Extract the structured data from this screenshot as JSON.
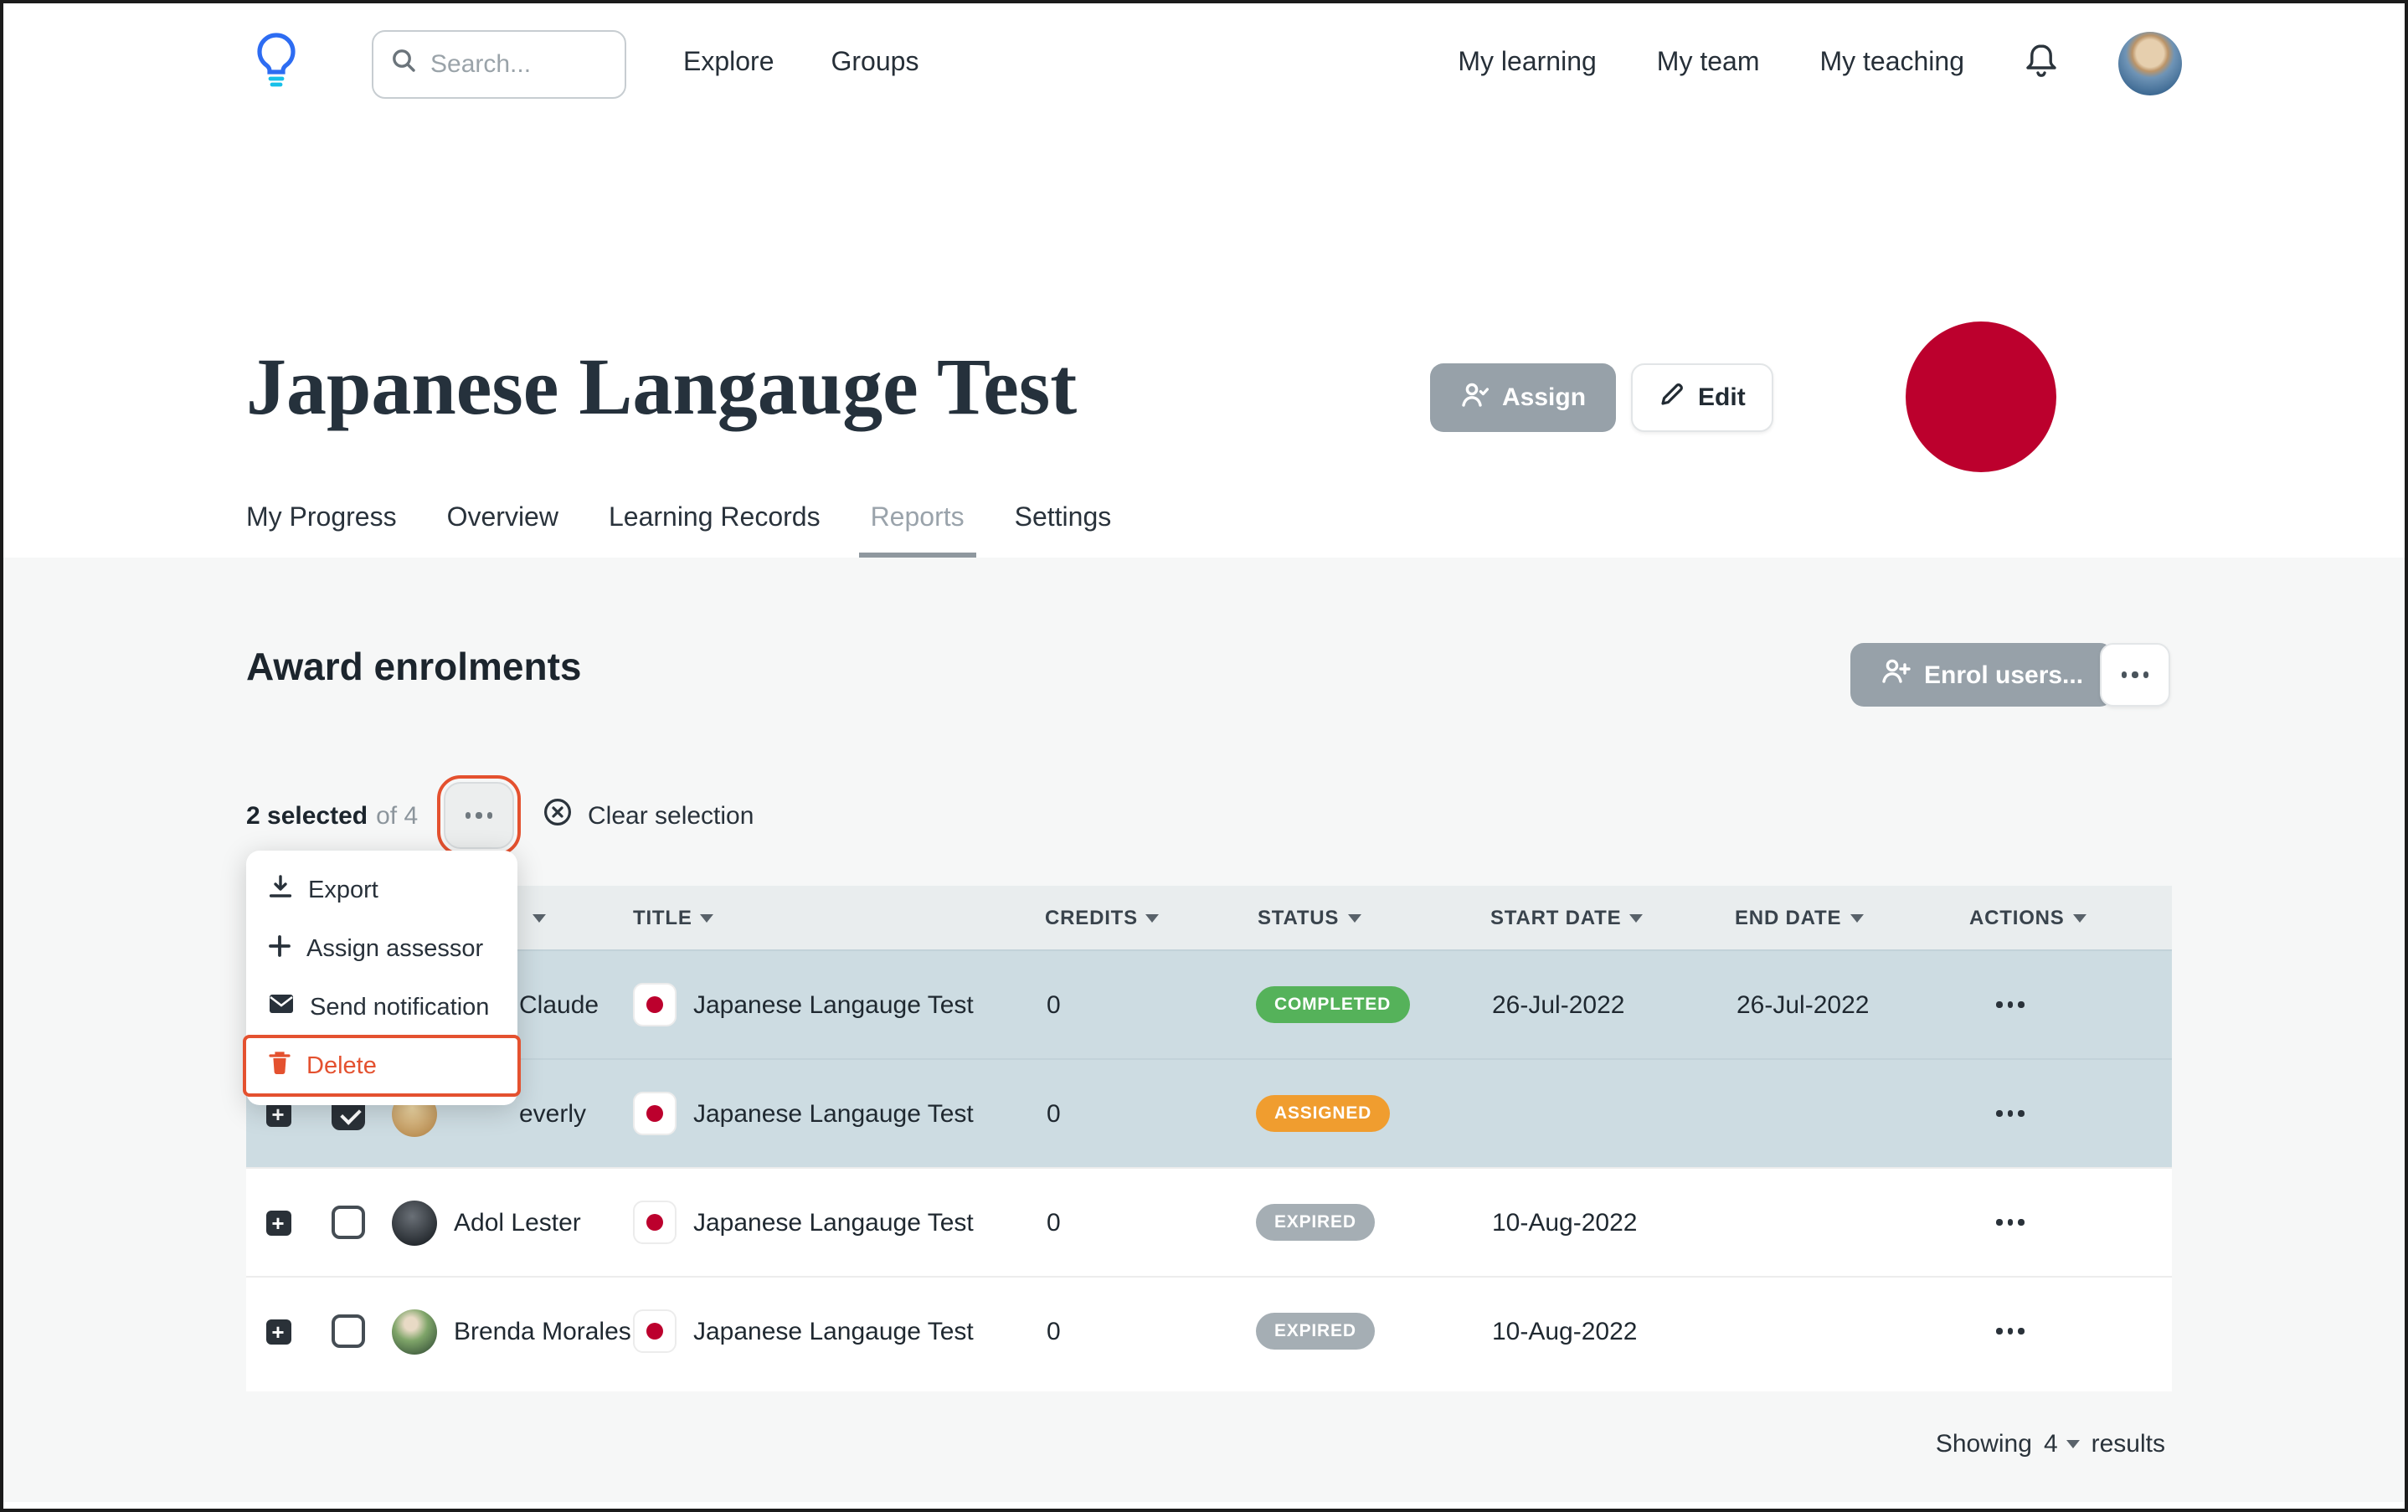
{
  "nav": {
    "search": {
      "placeholder": "Search..."
    },
    "links": [
      {
        "label": "Explore"
      },
      {
        "label": "Groups"
      }
    ],
    "user_links": [
      {
        "label": "My learning"
      },
      {
        "label": "My team"
      },
      {
        "label": "My teaching"
      }
    ]
  },
  "header": {
    "title": "Japanese Langauge Test",
    "assign_label": "Assign",
    "edit_label": "Edit"
  },
  "tabs": [
    {
      "label": "My Progress"
    },
    {
      "label": "Overview"
    },
    {
      "label": "Learning Records"
    },
    {
      "label": "Reports",
      "active": true
    },
    {
      "label": "Settings"
    }
  ],
  "main": {
    "heading": "Award enrolments",
    "enrol_label": "Enrol users...",
    "more_label": "...",
    "selection": {
      "count_label": "2 selected",
      "of_label": "of 4",
      "more_label": "...",
      "clear_label": "Clear selection"
    },
    "menu": {
      "items": [
        {
          "label": "Export",
          "icon": "download-icon"
        },
        {
          "label": "Assign assessor",
          "icon": "plus-icon"
        },
        {
          "label": "Send notification",
          "icon": "envelope-icon"
        },
        {
          "label": "Delete",
          "icon": "trash-icon",
          "danger": true,
          "highlighted": true
        }
      ]
    },
    "table": {
      "headers": [
        {
          "label": "TITLE"
        },
        {
          "label": "CREDITS"
        },
        {
          "label": "STATUS"
        },
        {
          "label": "START DATE"
        },
        {
          "label": "END DATE"
        },
        {
          "label": "ACTIONS"
        }
      ],
      "rows": [
        {
          "learner": "Claude",
          "title": "Japanese Langauge Test",
          "credits": "0",
          "status": "COMPLETED",
          "start_date": "26-Jul-2022",
          "end_date": "26-Jul-2022",
          "selected": true
        },
        {
          "learner": "everly",
          "title": "Japanese Langauge Test",
          "credits": "0",
          "status": "ASSIGNED",
          "start_date": "",
          "end_date": "",
          "selected": true
        },
        {
          "learner": "Adol Lester",
          "title": "Japanese Langauge Test",
          "credits": "0",
          "status": "EXPIRED",
          "start_date": "10-Aug-2022",
          "end_date": "",
          "selected": false
        },
        {
          "learner": "Brenda Morales",
          "title": "Japanese Langauge Test",
          "credits": "0",
          "status": "EXPIRED",
          "start_date": "10-Aug-2022",
          "end_date": "",
          "selected": false
        }
      ]
    },
    "footer": {
      "showing_label": "Showing",
      "count": "4",
      "results_label": "results"
    }
  },
  "colors": {
    "badge_completed": "#55b25a",
    "badge_assigned": "#f09d2f",
    "badge_expired": "#a5aeb4",
    "selected_row": "#cddce2",
    "danger": "#e4512f",
    "flag_red": "#bc002d",
    "button_gray": "#97a1a9"
  }
}
